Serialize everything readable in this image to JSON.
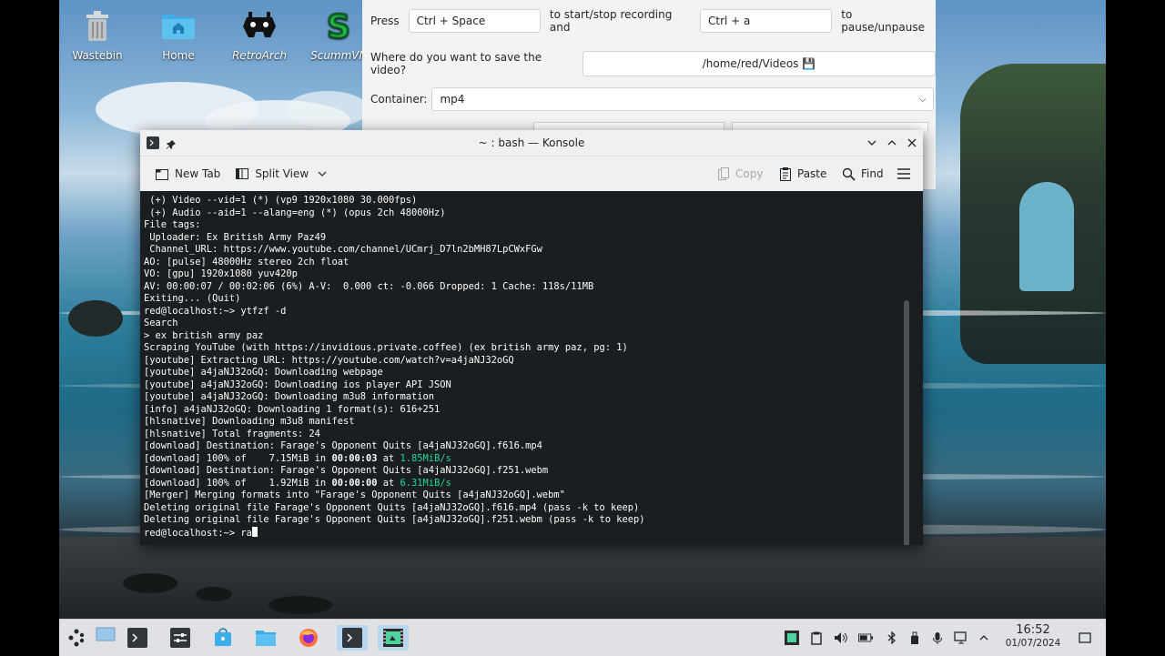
{
  "desktop": {
    "icons": [
      {
        "label": "Wastebin",
        "icon": "wastebin-icon"
      },
      {
        "label": "Home",
        "icon": "home-folder-icon"
      },
      {
        "label": "RetroArch",
        "icon": "retroarch-icon"
      },
      {
        "label": "ScummVM",
        "icon": "scummvm-icon"
      }
    ]
  },
  "recorder": {
    "press_label": "Press",
    "hotkey_record": "Ctrl + Space",
    "mid_label": "to start/stop recording and",
    "hotkey_pause": "Ctrl + a",
    "end_label": "to pause/unpause",
    "save_question": "Where do you want to save the video?",
    "save_path": "/home/red/Videos 💾",
    "container_label": "Container:",
    "container_value": "mp4"
  },
  "konsole": {
    "title": "~ : bash — Konsole",
    "toolbar": {
      "new_tab": "New Tab",
      "split_view": "Split View",
      "copy": "Copy",
      "paste": "Paste",
      "find": "Find"
    },
    "lines": [
      " (+) Video --vid=1 (*) (vp9 1920x1080 30.000fps)",
      " (+) Audio --aid=1 --alang=eng (*) (opus 2ch 48000Hz)",
      "File tags:",
      " Uploader: Ex British Army Paz49",
      " Channel_URL: https://www.youtube.com/channel/UCmrj_D7ln2bMH87LpCWxFGw",
      "AO: [pulse] 48000Hz stereo 2ch float",
      "VO: [gpu] 1920x1080 yuv420p",
      "AV: 00:00:07 / 00:02:06 (6%) A-V:  0.000 ct: -0.066 Dropped: 1 Cache: 118s/11MB",
      "Exiting... (Quit)",
      "red@localhost:~> ytfzf -d",
      "Search",
      "> ex british army paz",
      "Scraping YouTube (with https://invidious.private.coffee) (ex british army paz, pg: 1)",
      "[youtube] Extracting URL: https://youtube.com/watch?v=a4jaNJ32oGQ",
      "[youtube] a4jaNJ32oGQ: Downloading webpage",
      "[youtube] a4jaNJ32oGQ: Downloading ios player API JSON",
      "[youtube] a4jaNJ32oGQ: Downloading m3u8 information",
      "[info] a4jaNJ32oGQ: Downloading 1 format(s): 616+251",
      "[hlsnative] Downloading m3u8 manifest",
      "[hlsnative] Total fragments: 24",
      "[download] Destination: Farage's Opponent Quits [a4jaNJ32oGQ].f616.mp4"
    ],
    "dl1": {
      "prefix": "[download] 100% of    7.15MiB in ",
      "time": "00:00:03",
      "at": " at ",
      "speed": "1.85MiB/s"
    },
    "line_mid": "[download] Destination: Farage's Opponent Quits [a4jaNJ32oGQ].f251.webm",
    "dl2": {
      "prefix": "[download] 100% of    1.92MiB in ",
      "time": "00:00:00",
      "at": " at ",
      "speed": "6.31MiB/s"
    },
    "lines_end": [
      "[Merger] Merging formats into \"Farage's Opponent Quits [a4jaNJ32oGQ].webm\"",
      "Deleting original file Farage's Opponent Quits [a4jaNJ32oGQ].f616.mp4 (pass -k to keep)",
      "Deleting original file Farage's Opponent Quits [a4jaNJ32oGQ].f251.webm (pass -k to keep)"
    ],
    "prompt": "red@localhost:~> ",
    "typed": "ra"
  },
  "taskbar": {
    "time": "16:52",
    "date": "01/07/2024"
  },
  "colors": {
    "terminal_bg": "#1b1e20",
    "terminal_fg": "#fcfcfc",
    "speed_green": "#1cdc9a",
    "panel_bg": "#dfe1e4"
  }
}
